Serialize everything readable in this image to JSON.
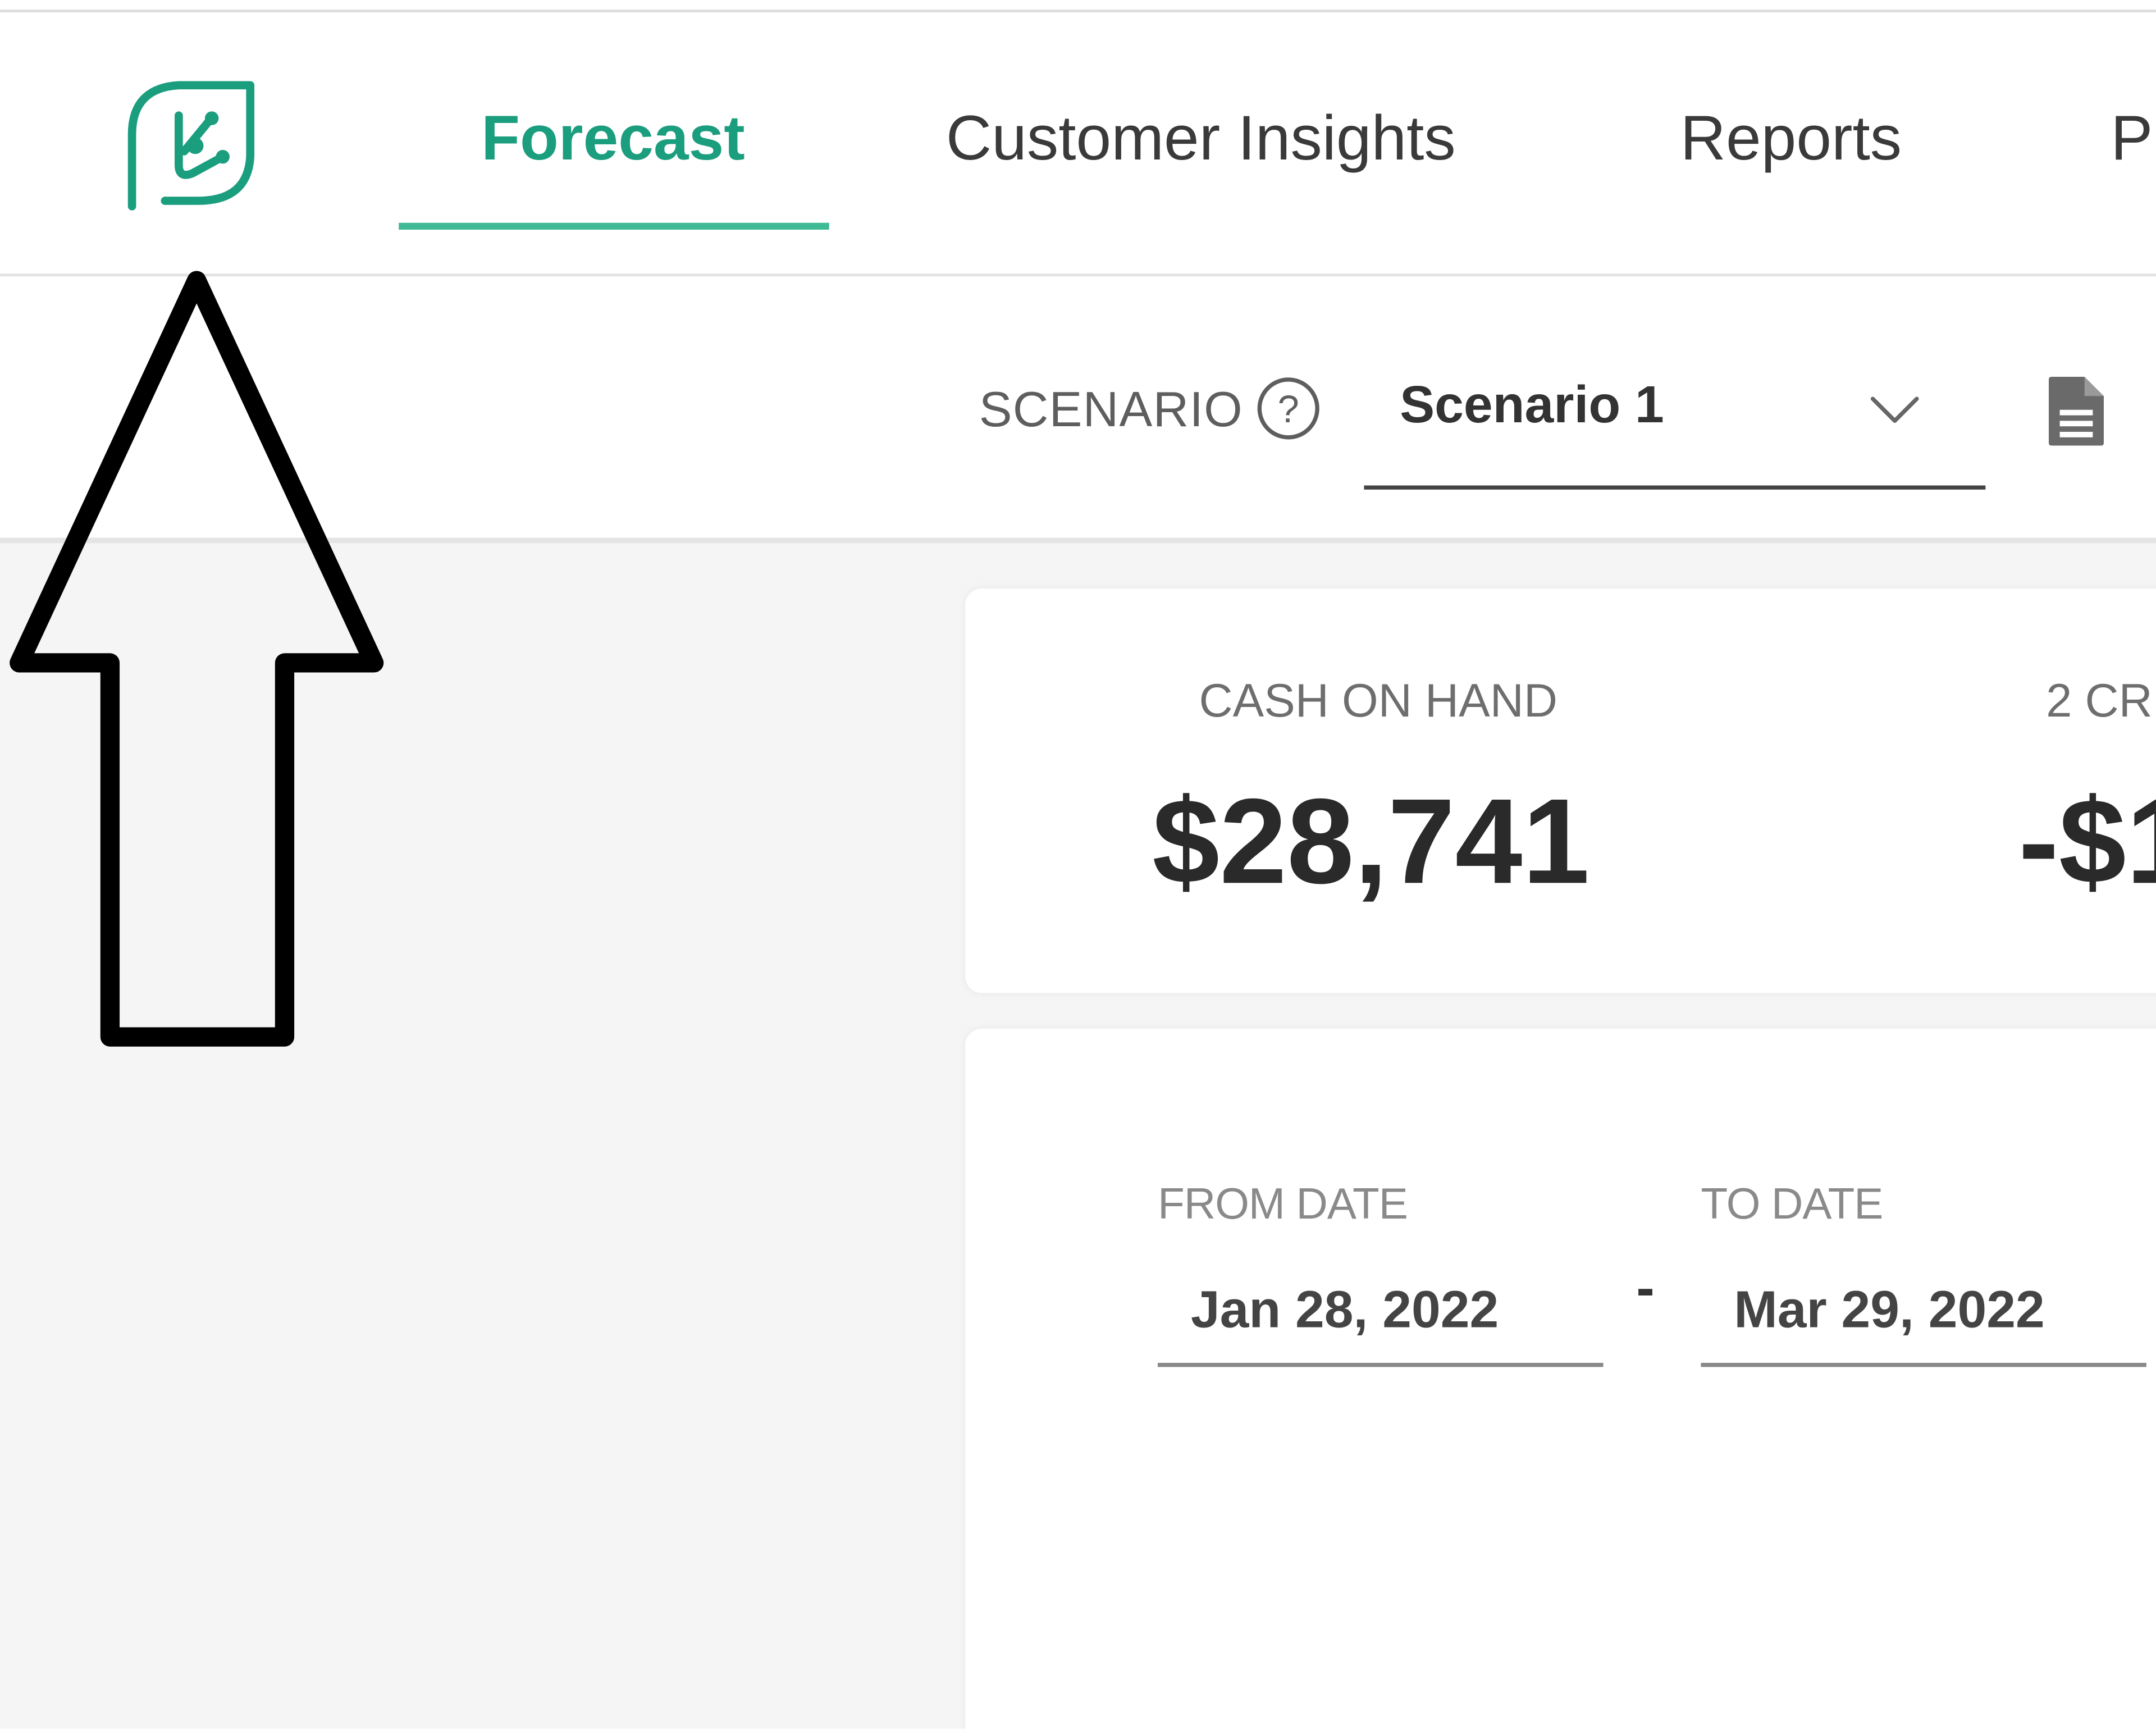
{
  "colors": {
    "accent": "#1b9e7e",
    "underline": "#3fba95",
    "background": "#f5f5f5"
  },
  "nav": {
    "logo_icon": "leaf-logo-icon",
    "tabs": [
      {
        "label": "Forecast",
        "active": true
      },
      {
        "label": "Customer Insights",
        "active": false
      },
      {
        "label": "Reports",
        "active": false
      },
      {
        "label": "P",
        "active": false
      }
    ]
  },
  "toolbar": {
    "scenario_label": "SCENARIO",
    "help_icon": "question-circle-icon",
    "scenario_value": "Scenario 1",
    "dropdown_icon": "chevron-down-icon",
    "doc_icon": "document-icon"
  },
  "summary": {
    "cash_on_hand": {
      "label": "CASH ON HAND",
      "value": "$28,741"
    },
    "second_metric": {
      "label": "2 CR",
      "value": "-$1"
    }
  },
  "date_range": {
    "from_label": "FROM DATE",
    "from_value": "Jan 28, 2022",
    "separator": "-",
    "to_label": "TO DATE",
    "to_value": "Mar 29, 2022"
  },
  "annotation": {
    "icon": "up-arrow-annotation-icon"
  }
}
